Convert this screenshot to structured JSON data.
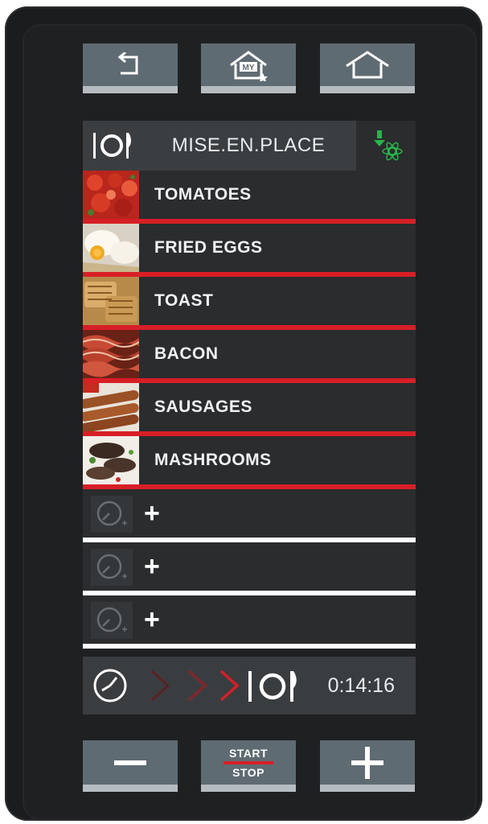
{
  "top_buttons": [
    {
      "name": "back-button",
      "icon": "back-arrow-icon"
    },
    {
      "name": "my-home-button",
      "icon": "my-home-icon",
      "badge": "MY"
    },
    {
      "name": "home-button",
      "icon": "home-icon"
    }
  ],
  "header": {
    "icon": "cutlery-plate-icon",
    "title": "MISE.EN.PLACE",
    "status_icon": "green-status-icon"
  },
  "foods": [
    {
      "label": "TOMATOES",
      "thumb": "tomatoes"
    },
    {
      "label": "FRIED EGGS",
      "thumb": "fried-eggs"
    },
    {
      "label": "TOAST",
      "thumb": "toast"
    },
    {
      "label": "BACON",
      "thumb": "bacon"
    },
    {
      "label": "SAUSAGES",
      "thumb": "sausages"
    },
    {
      "label": "MASHROOMS",
      "thumb": "mushrooms"
    }
  ],
  "empty_slots": [
    {
      "plus": "+"
    },
    {
      "plus": "+"
    },
    {
      "plus": "+"
    }
  ],
  "progress": {
    "time": "0:14:16"
  },
  "bottom_buttons": {
    "minus": "−",
    "start": "START",
    "stop": "STOP",
    "plus": "+"
  },
  "colors": {
    "accent_red": "#d71f26",
    "button_gray": "#5f6b72",
    "status_green": "#2bb34a"
  }
}
